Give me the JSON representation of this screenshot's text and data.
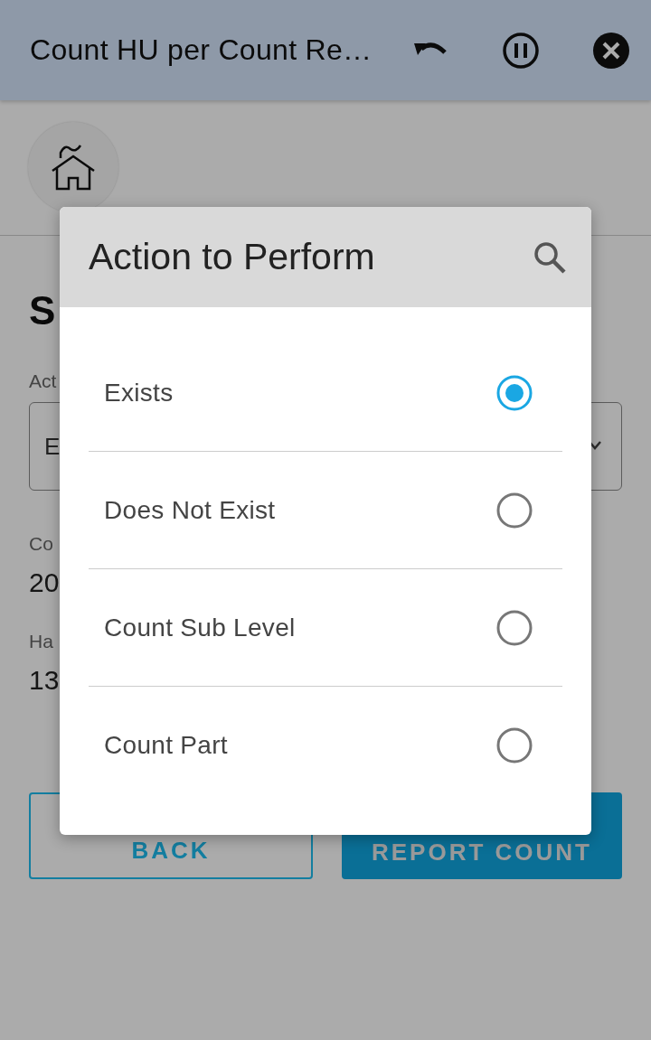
{
  "header": {
    "title": "Count HU per Count Re…"
  },
  "page": {
    "heading": "S",
    "fields": [
      {
        "label": "Act",
        "kind": "dropdown",
        "value": "E"
      },
      {
        "label": "Co",
        "kind": "text",
        "value": "20"
      },
      {
        "label": "Ha",
        "kind": "text",
        "value": "13"
      }
    ],
    "buttons": [
      {
        "label": "BACK",
        "kind": "outlined"
      },
      {
        "label": "REPORT COUNT",
        "kind": "filled"
      }
    ]
  },
  "dialog": {
    "title": "Action to Perform",
    "options": [
      {
        "label": "Exists",
        "selected": true
      },
      {
        "label": "Does Not Exist",
        "selected": false
      },
      {
        "label": "Count Sub Level",
        "selected": false
      },
      {
        "label": "Count Part",
        "selected": false
      }
    ]
  }
}
